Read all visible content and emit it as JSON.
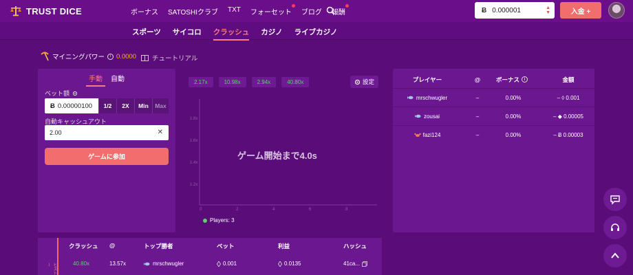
{
  "header": {
    "brand": "TRUST DICE",
    "nav": [
      {
        "label": "ボーナス",
        "dot": false
      },
      {
        "label": "SATOSHIクラブ",
        "dot": false
      },
      {
        "label": "TXT",
        "dot": false
      },
      {
        "label": "フォーセット",
        "dot": true
      },
      {
        "label": "ブログ",
        "dot": false
      },
      {
        "label": "報酬",
        "dot": true
      }
    ],
    "balance": "0.000001",
    "currency_symbol": "Ƀ",
    "deposit_label": "入金 +"
  },
  "subnav": {
    "items": [
      "スポーツ",
      "サイコロ",
      "クラッシュ",
      "カジノ",
      "ライブカジノ"
    ],
    "active_index": 2
  },
  "mining": {
    "label": "マイニングパワー",
    "value": "0.0000",
    "tutorial_label": "チュートリアル"
  },
  "bet": {
    "tabs": [
      "手動",
      "自動"
    ],
    "active_tab": 0,
    "amount_label": "ベット額",
    "amount_value": "0.00000100",
    "quick_buttons": [
      "1/2",
      "2X",
      "Min",
      "Max"
    ],
    "cashout_label": "自動キャッシュアウト",
    "cashout_value": "2.00",
    "join_label": "ゲームに参加"
  },
  "game": {
    "recent_multipliers": [
      "2.17x",
      "10.98x",
      "2.94x",
      "40.80x"
    ],
    "settings_label": "設定",
    "countdown_text": "ゲーム開始まで4.0s",
    "players_text": "Players: 3",
    "y_ticks": [
      "1.8x",
      "1.6x",
      "1.4x",
      "1.2x"
    ],
    "x_ticks": [
      "0",
      "2",
      "4",
      "6",
      "8"
    ]
  },
  "players_table": {
    "headers": {
      "player": "プレイヤー",
      "at": "@",
      "bonus": "ボーナス",
      "amount": "金額"
    },
    "rows": [
      {
        "name": "mrschwugler",
        "icon": "fish",
        "at": "–",
        "bonus": "0.00%",
        "amount": "– ◊ 0.001"
      },
      {
        "name": "zousai",
        "icon": "fish",
        "at": "–",
        "bonus": "0.00%",
        "amount": "– ◆ 0.00005"
      },
      {
        "name": "fazi124",
        "icon": "crab",
        "at": "–",
        "bonus": "0.00%",
        "amount": "– Ƀ 0.00003"
      }
    ]
  },
  "history": {
    "side_label": "ヒストリー",
    "headers": [
      "クラッシュ",
      "@",
      "トップ勝者",
      "ベット",
      "利益",
      "ハッシュ"
    ],
    "row": {
      "crash": "40.80x",
      "at": "13.57x",
      "winner": "mrschwugler",
      "bet": "0.001",
      "profit": "0.0135",
      "hash": "41ca..."
    }
  },
  "colors": {
    "background": "#5a0d78",
    "panel": "#6a1790",
    "accent": "#f26d6d",
    "green": "#5bd46a",
    "gold": "#ffb400"
  }
}
